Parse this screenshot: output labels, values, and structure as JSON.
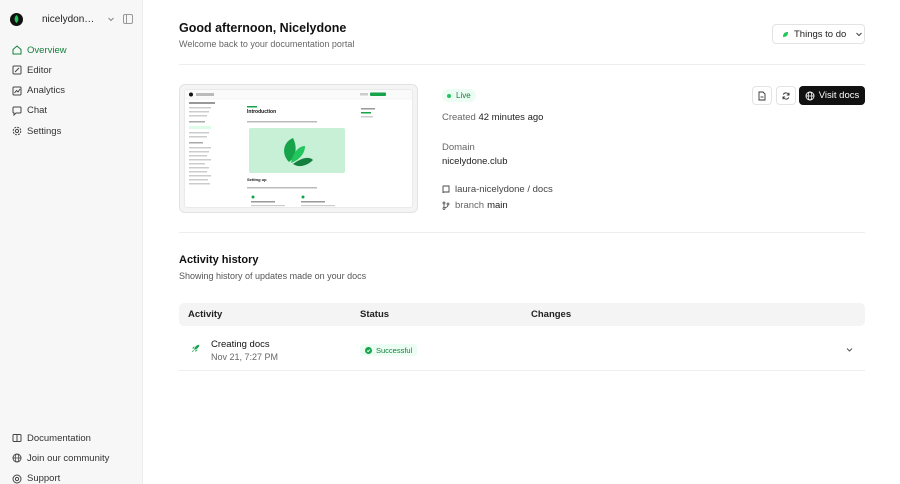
{
  "workspace": {
    "name": "nicelydone-..."
  },
  "sidebar": {
    "items": [
      {
        "label": "Overview",
        "icon": "home-icon",
        "active": true
      },
      {
        "label": "Editor",
        "icon": "edit-icon"
      },
      {
        "label": "Analytics",
        "icon": "analytics-icon"
      },
      {
        "label": "Chat",
        "icon": "chat-icon"
      },
      {
        "label": "Settings",
        "icon": "gear-icon"
      }
    ],
    "bottom": [
      {
        "label": "Documentation",
        "icon": "book-icon"
      },
      {
        "label": "Join our community",
        "icon": "globe-icon"
      },
      {
        "label": "Support",
        "icon": "support-icon"
      }
    ]
  },
  "header": {
    "greeting": "Good afternoon, Nicelydone",
    "subtitle": "Welcome back to your documentation portal",
    "todo_label": "Things to do"
  },
  "deployment": {
    "status": "Live",
    "created_prefix": "Created",
    "created_time": "42 minutes ago",
    "domain_label": "Domain",
    "domain": "nicelydone.club",
    "repo": "laura-nicelydone / docs",
    "branch_label": "branch",
    "branch": "main",
    "visit_label": "Visit docs"
  },
  "preview": {
    "page_title": "Introduction",
    "section_title": "Setting up"
  },
  "activity": {
    "title": "Activity history",
    "subtitle": "Showing history of updates made on your docs",
    "columns": [
      "Activity",
      "Status",
      "Changes"
    ],
    "rows": [
      {
        "title": "Creating docs",
        "date": "Nov 21, 7:27 PM",
        "status": "Successful"
      }
    ]
  },
  "colors": {
    "accent": "#15803d",
    "success_bg": "#ecfdf3",
    "dark_button": "#111111"
  }
}
